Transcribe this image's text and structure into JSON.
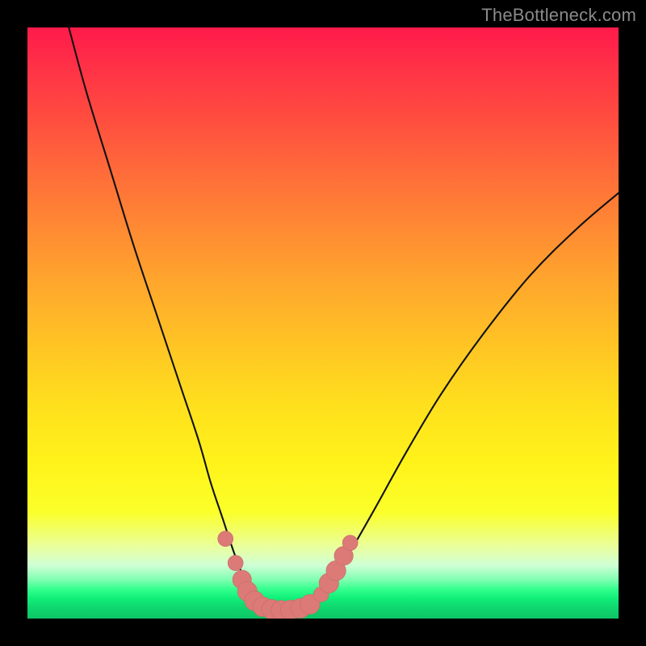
{
  "watermark": "TheBottleneck.com",
  "colors": {
    "frame": "#000000",
    "curve_stroke": "#111111",
    "marker_fill": "#db7a77",
    "marker_stroke": "#c96b68"
  },
  "chart_data": {
    "type": "line",
    "title": "",
    "xlabel": "",
    "ylabel": "",
    "xlim": [
      0,
      100
    ],
    "ylim": [
      0,
      100
    ],
    "grid": false,
    "description": "Bottleneck curve: V-shaped line where y≈0 is optimal. Two branches descend from top-left and upper-right to a flat minimum near x≈38–48.",
    "series": [
      {
        "name": "bottleneck-curve",
        "x": [
          7,
          10,
          14,
          18,
          22,
          26,
          29,
          31,
          33,
          35,
          37,
          38.5,
          40,
          42,
          44,
          46,
          48,
          50,
          52,
          55,
          59,
          64,
          70,
          77,
          85,
          93,
          100
        ],
        "y": [
          100,
          89,
          76,
          63,
          51,
          39,
          30,
          23,
          17,
          11,
          6,
          3.8,
          2.3,
          1.6,
          1.4,
          1.5,
          2.3,
          4.2,
          7.2,
          12,
          19,
          28,
          38,
          48,
          58,
          66,
          72
        ]
      }
    ],
    "markers": [
      {
        "x": 33.5,
        "y": 13.5,
        "r": 1.0
      },
      {
        "x": 35.2,
        "y": 9.4,
        "r": 1.0
      },
      {
        "x": 36.3,
        "y": 6.6,
        "r": 1.4
      },
      {
        "x": 37.2,
        "y": 4.6,
        "r": 1.5
      },
      {
        "x": 38.4,
        "y": 3.0,
        "r": 1.5
      },
      {
        "x": 39.8,
        "y": 2.0,
        "r": 1.5
      },
      {
        "x": 41.3,
        "y": 1.55,
        "r": 1.5
      },
      {
        "x": 42.9,
        "y": 1.4,
        "r": 1.5
      },
      {
        "x": 44.5,
        "y": 1.45,
        "r": 1.5
      },
      {
        "x": 46.2,
        "y": 1.75,
        "r": 1.5
      },
      {
        "x": 47.8,
        "y": 2.4,
        "r": 1.5
      },
      {
        "x": 49.7,
        "y": 4.1,
        "r": 1.0
      },
      {
        "x": 51.0,
        "y": 6.0,
        "r": 1.5
      },
      {
        "x": 52.2,
        "y": 8.1,
        "r": 1.5
      },
      {
        "x": 53.5,
        "y": 10.6,
        "r": 1.4
      },
      {
        "x": 54.6,
        "y": 12.8,
        "r": 1.0
      }
    ]
  }
}
